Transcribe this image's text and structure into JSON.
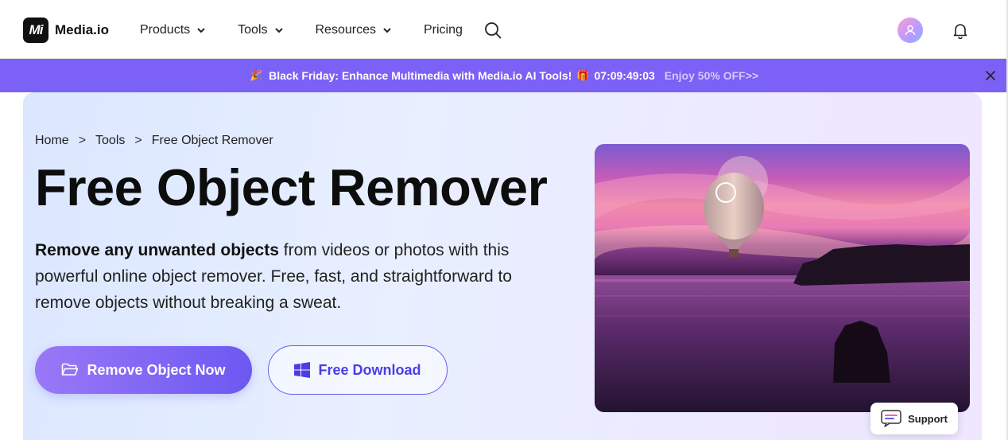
{
  "header": {
    "logo_mark": "Mi",
    "logo_text": "Media.io",
    "nav": [
      {
        "label": "Products",
        "dropdown": true
      },
      {
        "label": "Tools",
        "dropdown": true
      },
      {
        "label": "Resources",
        "dropdown": true
      },
      {
        "label": "Pricing",
        "dropdown": false
      }
    ],
    "icons": [
      "search-icon",
      "avatar",
      "bell-icon"
    ]
  },
  "promo": {
    "text": "Black Friday: Enhance Multimedia with Media.io AI Tools!",
    "timer": "07:09:49:03",
    "offer": "Enjoy 50% OFF>>",
    "background": "#7b61f5"
  },
  "breadcrumb": {
    "items": [
      "Home",
      "Tools",
      "Free Object Remover"
    ],
    "separator": ">"
  },
  "hero": {
    "title": "Free Object Remover",
    "desc_bold": "Remove any unwanted objects",
    "desc_rest": " from videos or photos with this powerful online object remover. Free, fast, and straightforward to remove objects without breaking a sweat.",
    "primary_button": "Remove Object Now",
    "secondary_button": "Free Download",
    "accent": "#6c58f2"
  },
  "support": {
    "label": "Support"
  }
}
